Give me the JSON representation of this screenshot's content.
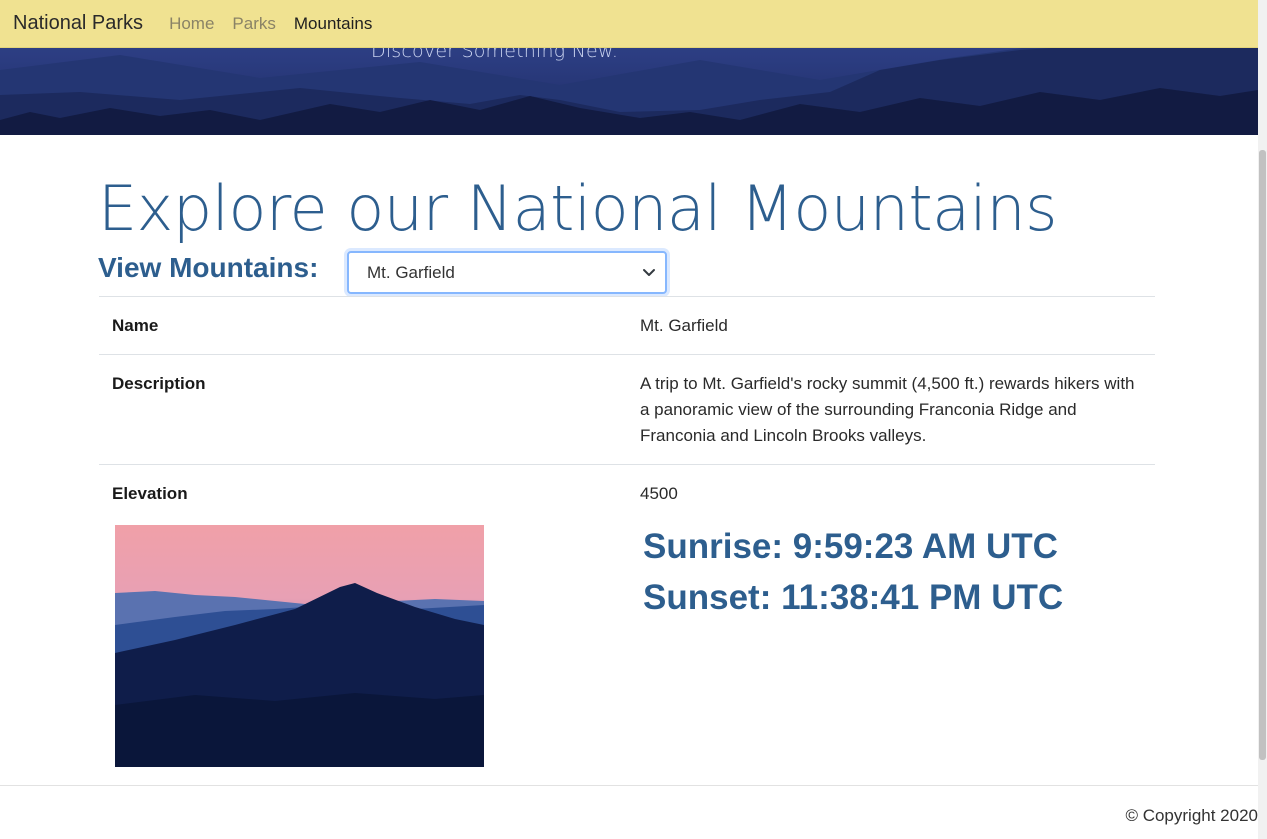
{
  "nav": {
    "brand": "National Parks",
    "links": [
      {
        "label": "Home",
        "active": false
      },
      {
        "label": "Parks",
        "active": false
      },
      {
        "label": "Mountains",
        "active": true
      }
    ]
  },
  "hero": {
    "tagline": "Discover Something New."
  },
  "main": {
    "title": "Explore our National Mountains",
    "view_label": "View Mountains:",
    "select": {
      "selected": "Mt. Garfield",
      "icon": "chevron-down-icon"
    },
    "details": [
      {
        "label": "Name",
        "value": "Mt. Garfield"
      },
      {
        "label": "Description",
        "value": "A trip to Mt. Garfield's rocky summit (4,500 ft.) rewards hikers with a panoramic view of the surrounding Franconia Ridge and Franconia and Lincoln Brooks valleys."
      },
      {
        "label": "Elevation",
        "value": "4500"
      }
    ],
    "sunrise": "Sunrise: 9:59:23 AM UTC",
    "sunset": "Sunset: 11:38:41 PM UTC"
  },
  "footer": {
    "copyright": "© Copyright 2020"
  },
  "colors": {
    "navbar": "#f0e291",
    "heading": "#2d5e8e",
    "hero_sky": "#34468f"
  }
}
